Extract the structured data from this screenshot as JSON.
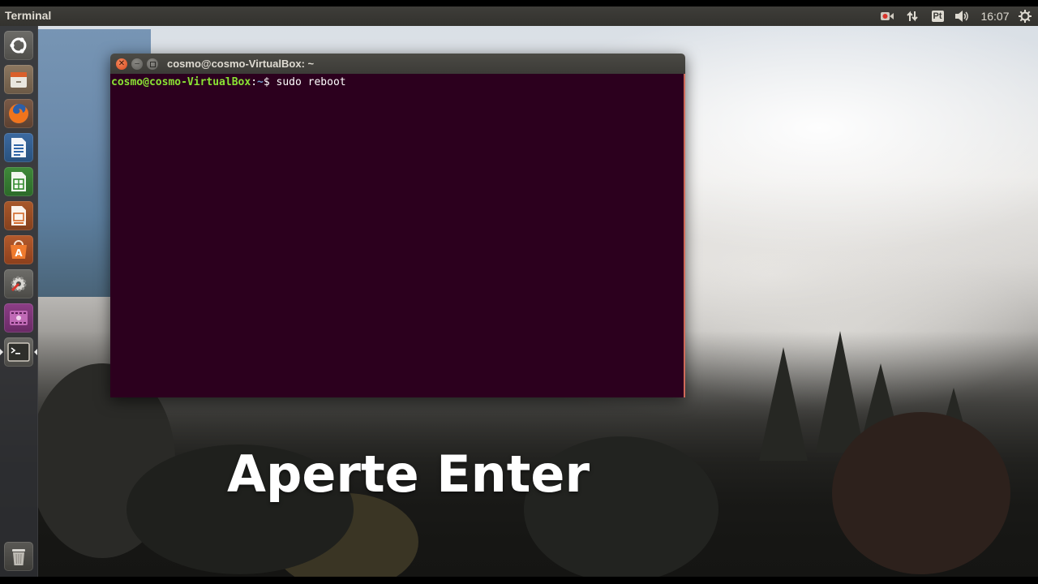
{
  "top_panel": {
    "app_name": "Terminal",
    "indicators": {
      "record_icon": "record-icon",
      "network_icon": "network-updown-icon",
      "keyboard_layout": "Pt",
      "volume_icon": "volume-icon",
      "clock": "16:07",
      "settings_icon": "gear-icon"
    }
  },
  "launcher": {
    "items": [
      {
        "name": "dash-home",
        "icon": "ubuntu-logo-icon"
      },
      {
        "name": "files",
        "icon": "file-cabinet-icon"
      },
      {
        "name": "firefox",
        "icon": "firefox-icon"
      },
      {
        "name": "writer",
        "icon": "libreoffice-writer-icon"
      },
      {
        "name": "calc",
        "icon": "libreoffice-calc-icon"
      },
      {
        "name": "impress",
        "icon": "libreoffice-impress-icon"
      },
      {
        "name": "software-center",
        "icon": "software-center-icon"
      },
      {
        "name": "system-settings",
        "icon": "system-settings-icon"
      },
      {
        "name": "video-editor",
        "icon": "video-editor-icon"
      },
      {
        "name": "terminal",
        "icon": "terminal-icon"
      },
      {
        "name": "trash",
        "icon": "trash-icon"
      }
    ]
  },
  "terminal": {
    "title": "cosmo@cosmo-VirtualBox: ~",
    "prompt_user_host": "cosmo@cosmo-VirtualBox",
    "prompt_sep": ":",
    "prompt_path": "~",
    "prompt_symbol": "$ ",
    "command": "sudo reboot"
  },
  "caption": "Aperte Enter",
  "colors": {
    "terminal_bg": "#2c001e",
    "prompt_user": "#8ae234",
    "prompt_path": "#729fcf",
    "close_button": "#e0542e"
  }
}
